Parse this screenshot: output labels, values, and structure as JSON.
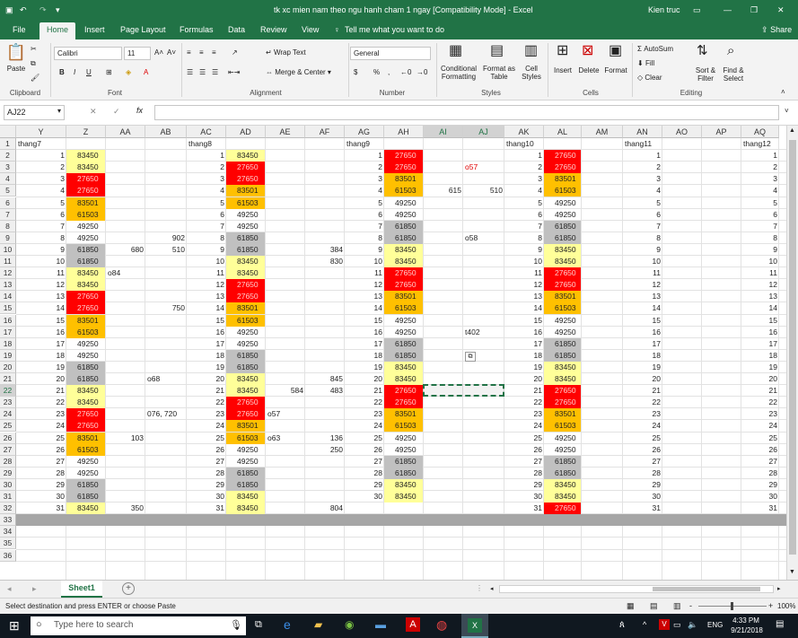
{
  "window": {
    "title": "tk xc mien nam theo ngu hanh cham 1 ngay  [Compatibility Mode]  -  Excel",
    "user": "Kien truc",
    "share_label": "Share",
    "restore_icon": "ribbon-display-icon",
    "colors": {
      "brand": "#217346",
      "red": "#ff0000",
      "orange": "#ffc000",
      "yellow": "#ffff99",
      "gray": "#c0c0c0"
    }
  },
  "ribbon_tabs": [
    "File",
    "Home",
    "Insert",
    "Page Layout",
    "Formulas",
    "Data",
    "Review",
    "View"
  ],
  "tell_me": "Tell me what you want to do",
  "ribbon": {
    "paste": "Paste",
    "clipboard": "Clipboard",
    "font_name": "Calibri",
    "font_size": "11",
    "font_group": "Font",
    "bold": "B",
    "italic": "I",
    "underline": "U",
    "wrap_text": "Wrap Text",
    "merge_center": "Merge & Center",
    "alignment_group": "Alignment",
    "number_format": "General",
    "number_group": "Number",
    "currency": "$",
    "percent": "%",
    "comma": ",",
    "cond_fmt": "Conditional Formatting",
    "format_table": "Format as Table",
    "cell_styles": "Cell Styles",
    "styles_group": "Styles",
    "insert": "Insert",
    "delete": "Delete",
    "format": "Format",
    "cells_group": "Cells",
    "autosum": "AutoSum",
    "fill": "Fill",
    "clear": "Clear",
    "sort_filter": "Sort & Filter",
    "find_select": "Find & Select",
    "editing_group": "Editing"
  },
  "formula_bar": {
    "name_box": "AJ22",
    "fx": "fx",
    "content": ""
  },
  "columns": [
    "Y",
    "Z",
    "AA",
    "AB",
    "AC",
    "AD",
    "AE",
    "AF",
    "AG",
    "AH",
    "AI",
    "AJ",
    "AK",
    "AL",
    "AM",
    "AN",
    "AO",
    "AP",
    "AQ"
  ],
  "rows": [
    "1",
    "2",
    "3",
    "4",
    "5",
    "6",
    "7",
    "8",
    "9",
    "10",
    "11",
    "12",
    "13",
    "14",
    "15",
    "16",
    "17",
    "18",
    "19",
    "20",
    "21",
    "22",
    "23",
    "24",
    "25",
    "26",
    "27",
    "28",
    "29",
    "30",
    "31",
    "32",
    "33",
    "34",
    "35",
    "36"
  ],
  "headers": {
    "thang7": "thang7",
    "thang8": "thang8",
    "thang9": "thang9",
    "thang10": "thang10",
    "thang11": "thang11",
    "thang12": "thang12"
  },
  "cells": {
    "y": [
      "1",
      "2",
      "3",
      "4",
      "5",
      "6",
      "7",
      "8",
      "9",
      "10",
      "11",
      "12",
      "13",
      "14",
      "15",
      "16",
      "17",
      "18",
      "19",
      "20",
      "21",
      "22",
      "23",
      "24",
      "25",
      "26",
      "27",
      "28",
      "29",
      "30",
      "31"
    ],
    "z": [
      "83450",
      "83450",
      "27650",
      "27650",
      "83501",
      "61503",
      "49250",
      "49250",
      "61850",
      "61850",
      "83450",
      "83450",
      "27650",
      "27650",
      "83501",
      "61503",
      "49250",
      "49250",
      "61850",
      "61850",
      "83450",
      "83450",
      "27650",
      "27650",
      "83501",
      "61503",
      "49250",
      "49250",
      "61850",
      "61850",
      "83450"
    ],
    "ac": [
      "1",
      "2",
      "3",
      "4",
      "5",
      "6",
      "7",
      "8",
      "9",
      "10",
      "11",
      "12",
      "13",
      "14",
      "15",
      "16",
      "17",
      "18",
      "19",
      "20",
      "21",
      "22",
      "23",
      "24",
      "25",
      "26",
      "27",
      "28",
      "29",
      "30",
      "31"
    ],
    "ad": [
      "83450",
      "27650",
      "27650",
      "83501",
      "61503",
      "49250",
      "49250",
      "61850",
      "61850",
      "83450",
      "83450",
      "27650",
      "27650",
      "83501",
      "61503",
      "49250",
      "49250",
      "61850",
      "61850",
      "83450",
      "83450",
      "27650",
      "27650",
      "83501",
      "61503",
      "49250",
      "49250",
      "61850",
      "61850",
      "83450",
      "83450"
    ],
    "ag": [
      "1",
      "2",
      "3",
      "4",
      "5",
      "6",
      "7",
      "8",
      "9",
      "10",
      "11",
      "12",
      "13",
      "14",
      "15",
      "16",
      "17",
      "18",
      "19",
      "20",
      "21",
      "22",
      "23",
      "24",
      "25",
      "26",
      "27",
      "28",
      "29",
      "30"
    ],
    "ah": [
      "27650",
      "27650",
      "83501",
      "61503",
      "49250",
      "49250",
      "61850",
      "61850",
      "83450",
      "83450",
      "27650",
      "27650",
      "83501",
      "61503",
      "49250",
      "49250",
      "61850",
      "61850",
      "83450",
      "83450",
      "27650",
      "27650",
      "83501",
      "61503",
      "49250",
      "49250",
      "61850",
      "61850",
      "83450",
      "83450"
    ],
    "ak": [
      "1",
      "2",
      "3",
      "4",
      "5",
      "6",
      "7",
      "8",
      "9",
      "10",
      "11",
      "12",
      "13",
      "14",
      "15",
      "16",
      "17",
      "18",
      "19",
      "20",
      "21",
      "22",
      "23",
      "24",
      "25",
      "26",
      "27",
      "28",
      "29",
      "30",
      "31"
    ],
    "al": [
      "27650",
      "27650",
      "83501",
      "61503",
      "49250",
      "49250",
      "61850",
      "61850",
      "83450",
      "83450",
      "27650",
      "27650",
      "83501",
      "61503",
      "49250",
      "49250",
      "61850",
      "61850",
      "83450",
      "83450",
      "27650",
      "27650",
      "83501",
      "61503",
      "49250",
      "49250",
      "61850",
      "61850",
      "83450",
      "83450",
      "27650"
    ],
    "an": [
      "1",
      "2",
      "3",
      "4",
      "5",
      "6",
      "7",
      "8",
      "9",
      "10",
      "11",
      "12",
      "13",
      "14",
      "15",
      "16",
      "17",
      "18",
      "19",
      "20",
      "21",
      "22",
      "23",
      "24",
      "25",
      "26",
      "27",
      "28",
      "29",
      "30",
      "31"
    ],
    "aq": [
      "1",
      "2",
      "3",
      "4",
      "5",
      "6",
      "7",
      "8",
      "9",
      "10",
      "11",
      "12",
      "13",
      "14",
      "15",
      "16",
      "17",
      "18",
      "19",
      "20",
      "21",
      "22",
      "23",
      "24",
      "25",
      "26",
      "27",
      "28",
      "29",
      "30",
      "31"
    ],
    "extras": {
      "aa10": "680",
      "ab10": "510",
      "ab9": "902",
      "aa12": "o84",
      "ab15": "750",
      "ab21": "o68",
      "ab24": "076, 720",
      "aa26": "103",
      "aa32": "350",
      "ae22": "584",
      "af22": "483",
      "ae24": "o57",
      "ae26": "o63",
      "af26": "136",
      "af27": "250",
      "af10": "384",
      "af11": "830",
      "af21": "845",
      "af32": "804",
      "aj3": "o57",
      "ai5": "615",
      "aj5": "510",
      "aj9": "o58",
      "aj17": "t402"
    }
  },
  "sheet": {
    "tab": "Sheet1",
    "add": "+"
  },
  "status": {
    "text": "Select destination and press ENTER or choose Paste",
    "zoom": "100%",
    "minus": "-",
    "plus": "+"
  },
  "taskbar": {
    "search": "Type here to search",
    "lang": "ENG",
    "time": "4:33 PM",
    "date": "9/21/2018"
  }
}
